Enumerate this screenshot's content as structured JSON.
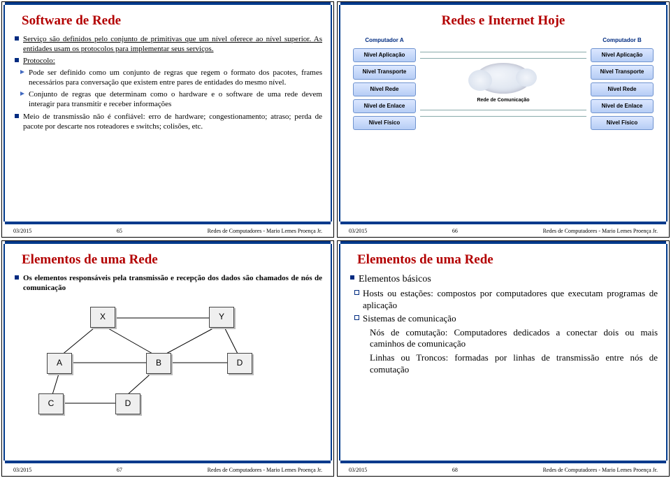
{
  "footer": {
    "date": "03/2015",
    "credit": "Redes de Computadores - Mario Lemes Proença Jr."
  },
  "slides": [
    {
      "num": "65",
      "title": "Software de Rede",
      "items": [
        {
          "t": "bsq",
          "u": true,
          "text": "Serviço são definidos pelo conjunto de primitivas que um nível oferece ao nível superior. As entidades usam os protocolos para implementar seus serviços."
        },
        {
          "t": "bsq",
          "u": true,
          "text": "Protocolo:"
        },
        {
          "t": "barr",
          "text": "Pode ser definido como um conjunto de regras que regem o formato dos pacotes, frames necessários para conversação que existem entre pares de entidades do mesmo nível."
        },
        {
          "t": "barr",
          "text": "Conjunto de regras que determinam como o hardware e o software de uma rede devem interagir para transmitir e receber informações"
        },
        {
          "t": "bsq",
          "text": "Meio de transmissão não é confiável: erro de hardware; congestionamento; atraso; perda de pacote por descarte nos roteadores e switchs; colisões, etc."
        }
      ]
    },
    {
      "num": "66",
      "title": "Redes e Internet Hoje",
      "compA": "Computador A",
      "compB": "Computador B",
      "cloud": "Rede de Comunicação",
      "layers": [
        "Nível Aplicação",
        "Nível Transporte",
        "Nível Rede",
        "Nível de Enlace",
        "Nível Físico"
      ]
    },
    {
      "num": "67",
      "title": "Elementos de uma Rede",
      "lead": "Os elementos responsáveis pela transmissão e recepção dos dados são chamados de nós de comunicação",
      "nodes": [
        "X",
        "Y",
        "A",
        "B",
        "D",
        "C",
        "D"
      ]
    },
    {
      "num": "68",
      "title": "Elementos de uma Rede",
      "items": [
        {
          "t": "bsq",
          "text": "Elementos básicos"
        },
        {
          "t": "bhsq",
          "text": "Hosts ou estações: compostos por computadores que executam programas de aplicação"
        },
        {
          "t": "bhsq",
          "text": "Sistemas de comunicação"
        },
        {
          "t": "plain",
          "text": "Nós de comutação: Computadores dedicados a conectar dois ou mais caminhos de comunicação"
        },
        {
          "t": "plain",
          "text": "Linhas ou Troncos: formadas por linhas de transmissão entre nós de comutação"
        }
      ]
    }
  ]
}
